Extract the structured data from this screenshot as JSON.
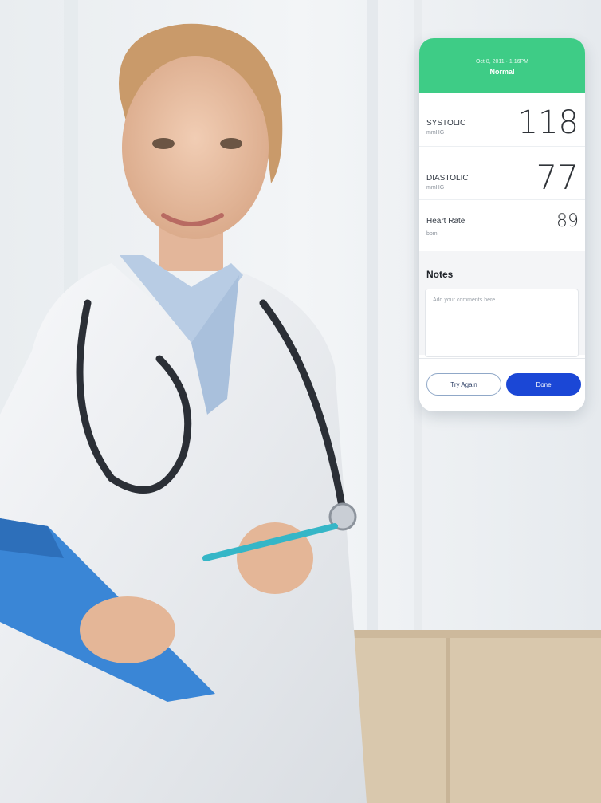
{
  "colors": {
    "header": "#3ecc86",
    "primary": "#1b47d6"
  },
  "reading": {
    "timestamp": "Oct 8, 2011 · 1:16PM",
    "status": "Normal"
  },
  "metrics": [
    {
      "label": "SYSTOLIC",
      "unit": "mmHG",
      "value": "118"
    },
    {
      "label": "DIASTOLIC",
      "unit": "mmHG",
      "value": "77"
    },
    {
      "label": "Heart Rate",
      "unit": "bpm",
      "value": "89"
    }
  ],
  "notes": {
    "title": "Notes",
    "placeholder": "Add your comments here"
  },
  "actions": {
    "try_again": "Try Again",
    "done": "Done"
  }
}
